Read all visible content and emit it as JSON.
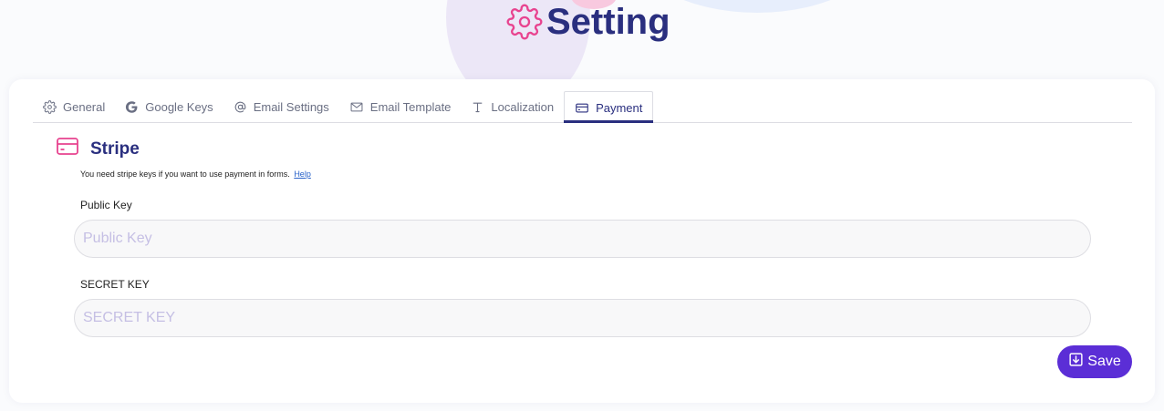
{
  "header": {
    "title": "Setting",
    "icon": "gear-icon"
  },
  "colors": {
    "brand": "#2a2f7f",
    "accent_pink": "#e8438f",
    "save_purple": "#5b2ed6",
    "link": "#2962c9",
    "placeholder": "#c5bfe4"
  },
  "tabs": [
    {
      "label": "General",
      "icon": "gear-icon",
      "active": false
    },
    {
      "label": "Google Keys",
      "icon": "google-icon",
      "active": false
    },
    {
      "label": "Email Settings",
      "icon": "at-sign-icon",
      "active": false
    },
    {
      "label": "Email Template",
      "icon": "envelope-icon",
      "active": false
    },
    {
      "label": "Localization",
      "icon": "text-icon",
      "active": false
    },
    {
      "label": "Payment",
      "icon": "credit-card-icon",
      "active": true
    }
  ],
  "section": {
    "title": "Stripe",
    "icon": "credit-card-icon",
    "help_text": "You need stripe keys if you want to use payment in forms.",
    "help_link": "Help"
  },
  "fields": {
    "public_key": {
      "label": "Public Key",
      "placeholder": "Public Key",
      "value": ""
    },
    "secret_key": {
      "label": "SECRET KEY",
      "placeholder": "SECRET KEY",
      "value": ""
    }
  },
  "actions": {
    "save_label": "Save",
    "save_icon": "download-icon"
  }
}
